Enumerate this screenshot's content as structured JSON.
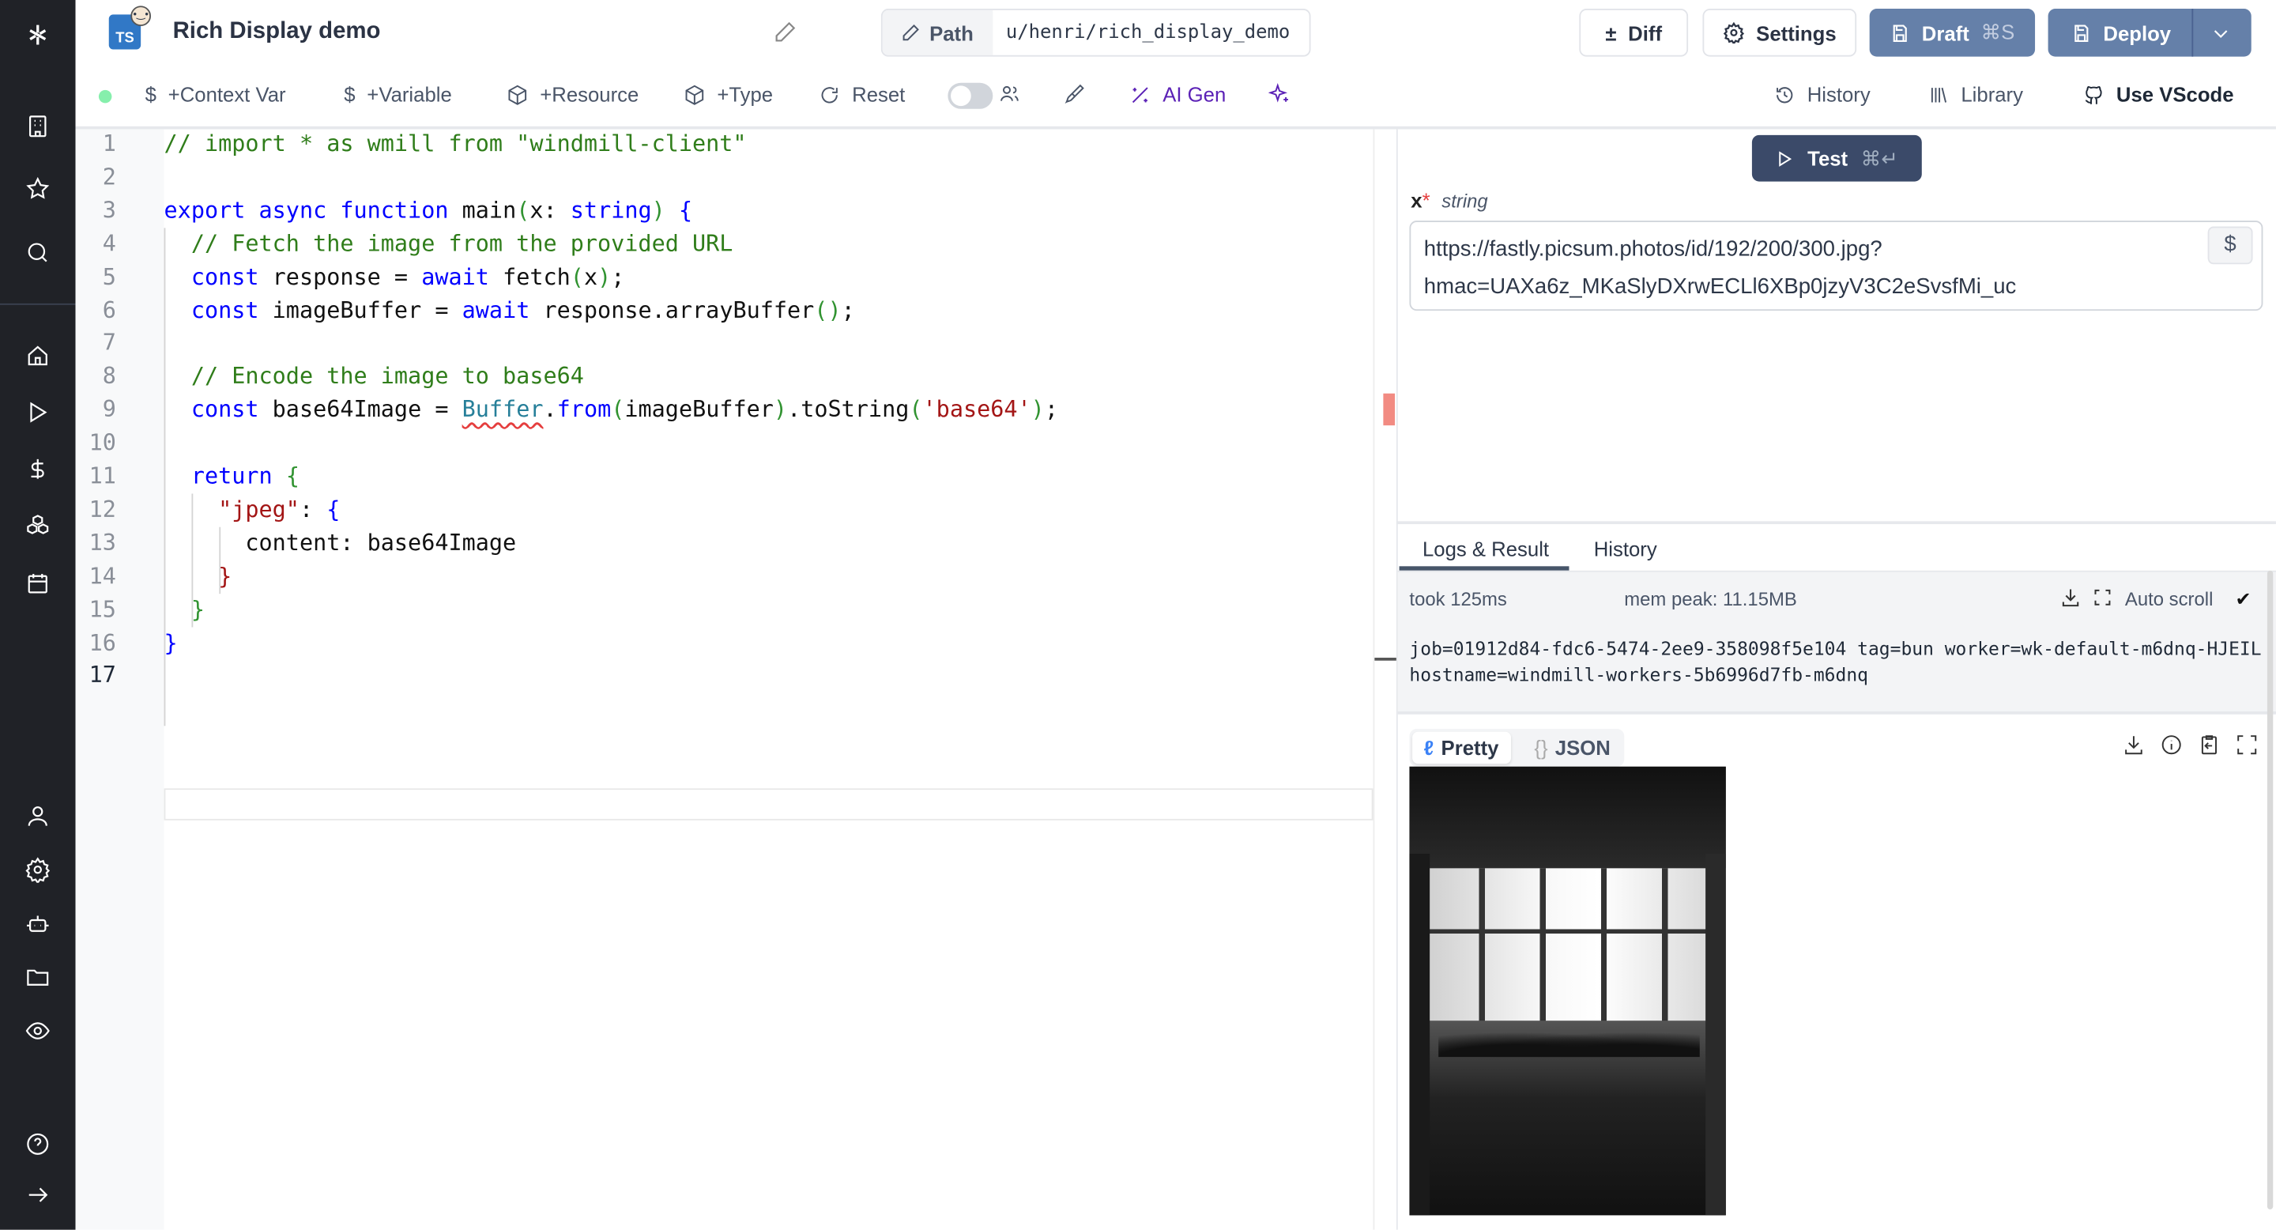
{
  "header": {
    "lang_badge": "TS",
    "title": "Rich Display demo",
    "path_label": "Path",
    "path_value": "u/henri/rich_display_demo",
    "buttons": {
      "diff": "Diff",
      "settings": "Settings",
      "draft": "Draft",
      "draft_kbd": "⌘S",
      "deploy": "Deploy"
    }
  },
  "toolbar": {
    "context_var": "+Context Var",
    "variable": "+Variable",
    "resource": "+Resource",
    "type": "+Type",
    "reset": "Reset",
    "ai_gen": "AI Gen",
    "history": "History",
    "library": "Library",
    "vscode": "Use VScode",
    "status_color": "#86efac",
    "ai_color": "#5b21b6"
  },
  "sidebar": {
    "top_icons": [
      "building-icon",
      "star-icon",
      "search-icon"
    ],
    "main_icons": [
      "home-icon",
      "play-icon",
      "dollar-icon",
      "boxes-icon",
      "calendar-icon"
    ],
    "bottom_icons": [
      "user-icon",
      "gear-icon",
      "bot-icon",
      "folder-icon",
      "eye-icon"
    ],
    "footer_icons": [
      "help-icon",
      "arrow-right-icon"
    ]
  },
  "code": {
    "current_line": 17,
    "lines": [
      [
        [
          "// import * as wmill from \"windmill-client\"",
          "c"
        ]
      ],
      [],
      [
        [
          "export async function ",
          "k"
        ],
        [
          "main",
          ""
        ],
        [
          "(",
          "p"
        ],
        [
          "x: ",
          ""
        ],
        [
          "string",
          "k"
        ],
        [
          ")",
          "p"
        ],
        [
          " ",
          ""
        ],
        [
          "{",
          "k"
        ]
      ],
      [
        [
          "  // Fetch the image from the provided URL",
          "c"
        ]
      ],
      [
        [
          "  const ",
          "k"
        ],
        [
          "response = ",
          ""
        ],
        [
          "await ",
          "k"
        ],
        [
          "fetch",
          ""
        ],
        [
          "(",
          "p"
        ],
        [
          "x",
          ""
        ],
        [
          ")",
          "p"
        ],
        [
          ";",
          ""
        ]
      ],
      [
        [
          "  const ",
          "k"
        ],
        [
          "imageBuffer = ",
          ""
        ],
        [
          "await ",
          "k"
        ],
        [
          "response.arrayBuffer",
          ""
        ],
        [
          "()",
          "p"
        ],
        [
          ";",
          ""
        ]
      ],
      [],
      [
        [
          "  // Encode the image to base64",
          "c"
        ]
      ],
      [
        [
          "  const ",
          "k"
        ],
        [
          "base64Image = ",
          ""
        ],
        [
          "Buffer",
          "t squig"
        ],
        [
          ".",
          ""
        ],
        [
          "from",
          "k"
        ],
        [
          "(",
          "p"
        ],
        [
          "imageBuffer",
          ""
        ],
        [
          ")",
          "p"
        ],
        [
          ".toString",
          ""
        ],
        [
          "(",
          "p"
        ],
        [
          "'base64'",
          "s"
        ],
        [
          ")",
          "p"
        ],
        [
          ";",
          ""
        ]
      ],
      [],
      [
        [
          "  return ",
          "k"
        ],
        [
          "{",
          "p"
        ]
      ],
      [
        [
          "    \"jpeg\"",
          "s"
        ],
        [
          ": ",
          ""
        ],
        [
          "{",
          "k"
        ]
      ],
      [
        [
          "      content: base64Image",
          ""
        ]
      ],
      [
        [
          "    }",
          "s"
        ]
      ],
      [
        [
          "  }",
          "p"
        ]
      ],
      [
        [
          "}",
          "k"
        ]
      ],
      []
    ]
  },
  "test": {
    "label": "Test",
    "kbd": "⌘↵"
  },
  "args": {
    "name": "x",
    "required": "*",
    "type": "string",
    "value": "https://fastly.picsum.photos/id/192/200/300.jpg?hmac=UAXa6z_MKaSlyDXrwECLl6XBp0jzyV3C2eSvsfMi_uc",
    "line1": "https://fastly.picsum.photos/id/192/200/300.jpg?",
    "line2": "hmac=UAXa6z_MKaSlyDXrwECLl6XBp0jzyV3C2eSvsfMi_uc",
    "dollar": "$"
  },
  "results": {
    "tabs": [
      "Logs & Result",
      "History"
    ],
    "took": "took 125ms",
    "mem": "mem peak: 11.15MB",
    "autoscroll": "Auto scroll",
    "autoscroll_checked": true,
    "log": "job=01912d84-fdc6-5474-2ee9-358098f5e104 tag=bun worker=wk-default-m6dnq-HJEIL hostname=windmill-workers-5b6996d7fb-m6dnq",
    "view_pretty": "Pretty",
    "view_json": "JSON",
    "selected_view": "Pretty"
  }
}
